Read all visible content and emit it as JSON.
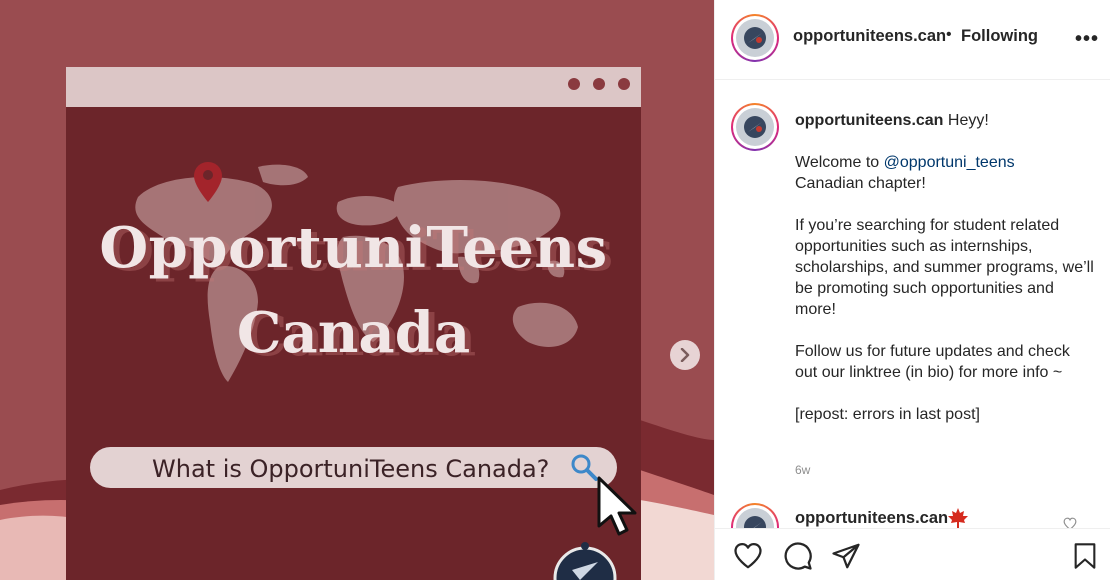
{
  "post": {
    "title_line1": "OpportuniTeens",
    "title_line2": "Canada",
    "search_text": "What is OpportuniTeens Canada?",
    "colors": {
      "media_bg": "#9a4c50",
      "panel": "#6c252a",
      "bar": "#dcc6c6"
    }
  },
  "header": {
    "username": "opportuniteens.can",
    "separator": "•",
    "follow_label": "Following",
    "more_label": "•••"
  },
  "caption": {
    "username": "opportuniteens.can",
    "greeting": "Heyy!",
    "welcome_prefix": "Welcome to ",
    "mention": "@opportuni_teens",
    "welcome_suffix": "Canadian chapter!",
    "para2": "If you’re searching for student related opportunities such as internships, scholarships, and summer programs, we’ll be promoting such opportunities and more!",
    "para3": "Follow us for future updates and check out our linktree (in bio) for more info ~",
    "para4": "[repost: errors in last post]",
    "time": "6w"
  },
  "next_comment": {
    "username": "opportuniteens.can"
  },
  "icons": {
    "like": "heart-icon",
    "comment": "comment-icon",
    "share": "share-icon",
    "save": "bookmark-icon",
    "next": "chevron-right-icon"
  }
}
